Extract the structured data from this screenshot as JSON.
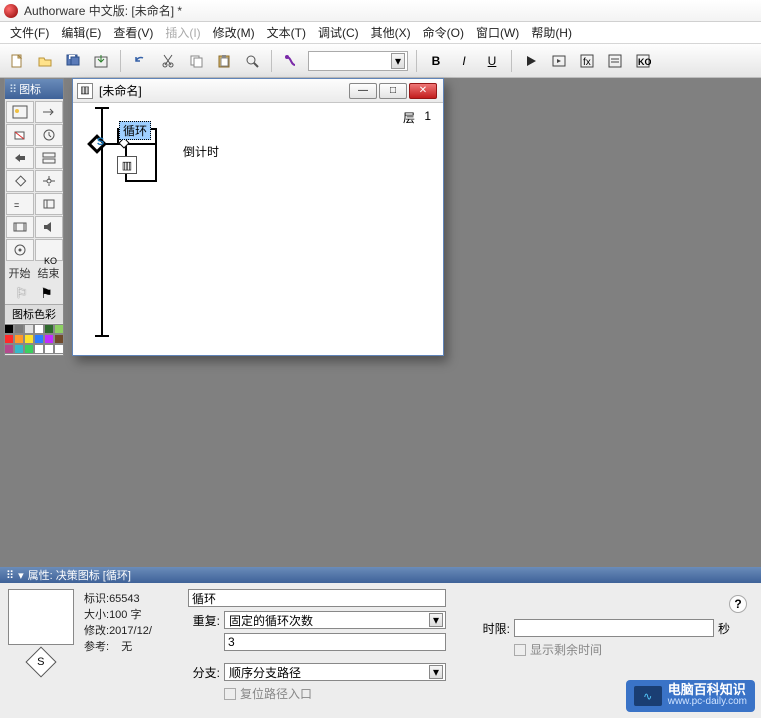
{
  "app": {
    "title": "Authorware 中文版: [未命名] *"
  },
  "menu": {
    "file": "文件(F)",
    "edit": "编辑(E)",
    "view": "查看(V)",
    "insert": "插入(I)",
    "modify": "修改(M)",
    "text": "文本(T)",
    "debug": "调试(C)",
    "other": "其他(X)",
    "command": "命令(O)",
    "window": "窗口(W)",
    "help": "帮助(H)"
  },
  "toolbar": {
    "bold": "B",
    "italic": "I",
    "underline": "U"
  },
  "palette": {
    "title": "图标",
    "start": "开始",
    "end": "结束",
    "color_title": "图标色彩",
    "colors": [
      "#000000",
      "#7a7a7a",
      "#e0e0e0",
      "#ffffff",
      "#2f6a2d",
      "#8ed063",
      "#ff2a2a",
      "#ff9a2a",
      "#ffe22a",
      "#2a7dff",
      "#c22aff",
      "#704a2a",
      "#b44a8d",
      "#37b9c9",
      "#3ccf5f",
      "#ffffff",
      "#ffffff",
      "#ffffff"
    ]
  },
  "design": {
    "title": "[未命名]",
    "layer_label": "层",
    "layer_value": "1",
    "loop_label": "循环",
    "countdown_label": "倒计时"
  },
  "prop": {
    "title": "属性: 决策图标 [循环]",
    "info": {
      "id_label": "标识:",
      "id_value": "65543",
      "size_label": "大小:",
      "size_value": "100 字",
      "mod_label": "修改:",
      "mod_value": "2017/12/",
      "ref_label": "参考:",
      "ref_value": "无"
    },
    "name_value": "循环",
    "repeat_label": "重复:",
    "repeat_value": "固定的循环次数",
    "repeat_count": "3",
    "branch_label": "分支:",
    "branch_value": "顺序分支路径",
    "reset_label": "复位路径入口",
    "time_label": "时限:",
    "time_unit": "秒",
    "show_remaining": "显示剩余时间",
    "help": "?"
  },
  "watermark": {
    "cn": "电脑百科知识",
    "en": "www.pc-daily.com"
  }
}
